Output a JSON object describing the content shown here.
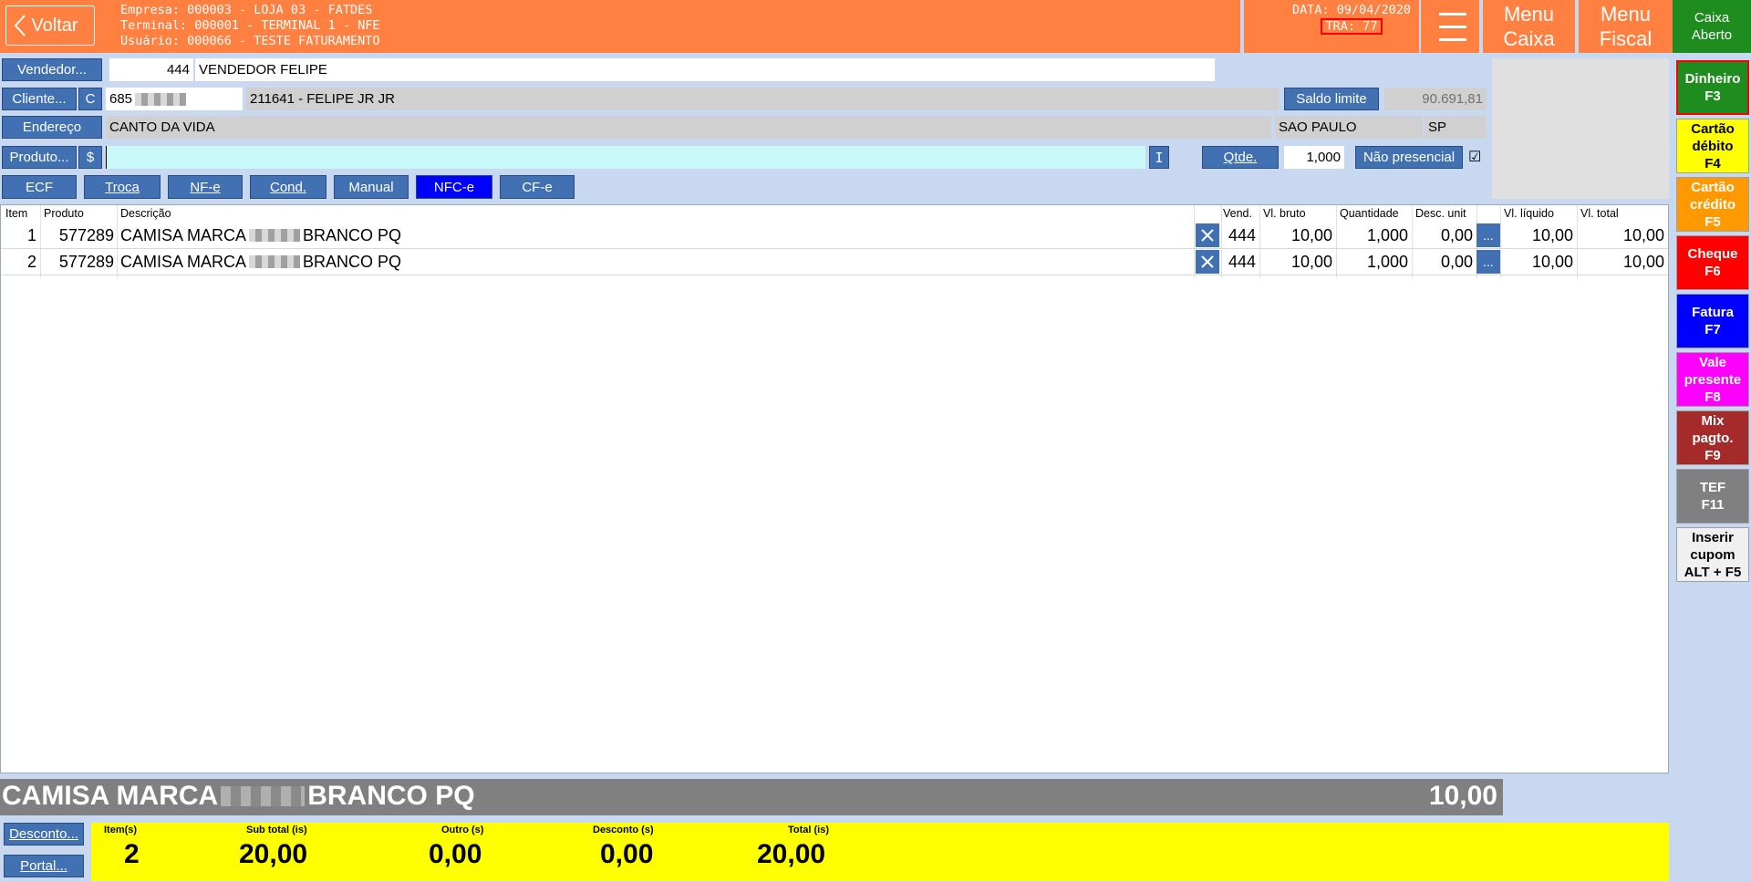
{
  "header": {
    "back_label": "Voltar",
    "empresa": "Empresa: 000003 - LOJA 03 - FATDES",
    "terminal": "Terminal: 000001 - TERMINAL 1 - NFE",
    "usuario": "Usuário: 000066 - TESTE FATURAMENTO",
    "data": "DATA: 09/04/2020",
    "tra": "TRA: 77",
    "menu_caixa_1": "Menu",
    "menu_caixa_2": "Caixa",
    "menu_fiscal_1": "Menu",
    "menu_fiscal_2": "Fiscal",
    "caixa_1": "Caixa",
    "caixa_2": "Aberto"
  },
  "form": {
    "vendedor_label": "Vendedor...",
    "vendedor_code": "444",
    "vendedor_name": "VENDEDOR FELIPE",
    "cliente_label": "Cliente...",
    "cliente_c": "C",
    "cliente_code": "685",
    "cliente_name": "211641 - FELIPE JR JR",
    "saldo_label": "Saldo limite",
    "saldo_value": "90.691,81",
    "endereco_label": "Endereço",
    "endereco": "CANTO DA VIDA",
    "cidade": "SAO PAULO",
    "uf": "SP",
    "produto_label": "Produto...",
    "produto_dollar": "$",
    "produto_value": "",
    "info_i": "I",
    "qtde_label": "Qtde.",
    "qtde_value": "1,000",
    "nao_presencial": "Não presencial",
    "check": "☑"
  },
  "tabs": {
    "ecf": "ECF",
    "troca": "Troca",
    "nfe": "NF-e",
    "cond": "Cond.",
    "manual": "Manual",
    "nfce": "NFC-e",
    "cfe": "CF-e"
  },
  "table": {
    "headers": {
      "item": "Item",
      "produto": "Produto",
      "descricao": "Descrição",
      "vend": "Vend.",
      "vl_bruto": "Vl. bruto",
      "quantidade": "Quantidade",
      "desc_unit": "Desc. unit",
      "vl_liquido": "Vl. líquido",
      "vl_total": "Vl. total"
    },
    "rows": [
      {
        "item": "1",
        "produto": "577289",
        "desc_a": "CAMISA MARCA",
        "desc_b": "BRANCO PQ",
        "vend": "444",
        "vl_bruto": "10,00",
        "quantidade": "1,000",
        "desc_unit": "0,00",
        "dots": "...",
        "vl_liquido": "10,00",
        "vl_total": "10,00"
      },
      {
        "item": "2",
        "produto": "577289",
        "desc_a": "CAMISA MARCA",
        "desc_b": "BRANCO PQ",
        "vend": "444",
        "vl_bruto": "10,00",
        "quantidade": "1,000",
        "desc_unit": "0,00",
        "dots": "...",
        "vl_liquido": "10,00",
        "vl_total": "10,00"
      }
    ]
  },
  "current": {
    "desc_a": "CAMISA MARCA",
    "desc_b": "BRANCO PQ",
    "value": "10,00"
  },
  "bottom": {
    "desconto_label": "Desconto...",
    "portal_label": "Portal...",
    "items_label": "Item(s)",
    "items_value": "2",
    "subtotal_label": "Sub total (is)",
    "subtotal_value": "20,00",
    "outro_label": "Outro (s)",
    "outro_value": "0,00",
    "desconto_total_label": "Desconto (s)",
    "desconto_total_value": "0,00",
    "total_label": "Total (is)",
    "total_value": "20,00"
  },
  "payments": {
    "dinheiro_1": "Dinheiro",
    "dinheiro_2": "F3",
    "debito_1": "Cartão",
    "debito_2": "débito",
    "debito_3": "F4",
    "credito_1": "Cartão",
    "credito_2": "crédito",
    "credito_3": "F5",
    "cheque_1": "Cheque",
    "cheque_2": "F6",
    "fatura_1": "Fatura",
    "fatura_2": "F7",
    "vale_1": "Vale",
    "vale_2": "presente",
    "vale_3": "F8",
    "mix_1": "Mix",
    "mix_2": "pagto.",
    "mix_3": "F9",
    "tef_1": "TEF",
    "tef_2": "F11",
    "cupom_1": "Inserir",
    "cupom_2": "cupom",
    "cupom_3": "ALT + F5"
  },
  "colors": {
    "header": "#ff8040",
    "button_blue": "#4171b3",
    "totals_bg": "#ffff00",
    "dinheiro": "#1e8c1e",
    "debito": "#ffff00",
    "credito": "#ff9900",
    "cheque": "#ff0000",
    "fatura": "#0000ff",
    "vale": "#ff00ff",
    "mix": "#a52a2a",
    "tef": "#808080"
  }
}
